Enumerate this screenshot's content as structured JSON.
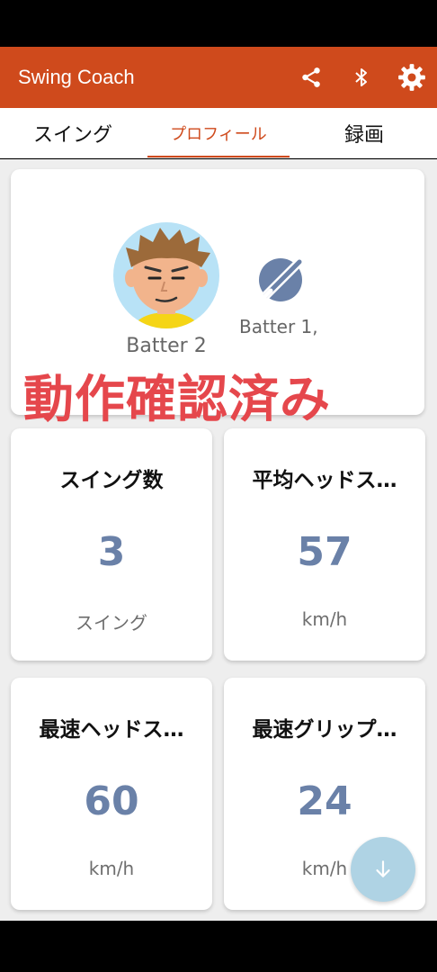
{
  "app": {
    "title": "Swing Coach"
  },
  "toolbar": {
    "share_icon": "share-icon",
    "bluetooth_icon": "bluetooth-icon",
    "settings_icon": "gear-icon"
  },
  "tabs": [
    {
      "label": "スイング",
      "active": false
    },
    {
      "label": "プロフィール",
      "active": true
    },
    {
      "label": "録画",
      "active": false
    }
  ],
  "profile": {
    "current_batter": "Batter 2",
    "other_batter": "Batter 1,"
  },
  "overlay": {
    "stamp_text": "動作確認済み"
  },
  "stats": [
    {
      "title": "スイング数",
      "value": "3",
      "unit": "スイング"
    },
    {
      "title": "平均ヘッドス…",
      "value": "57",
      "unit": "km/h"
    },
    {
      "title": "最速ヘッドス…",
      "value": "60",
      "unit": "km/h"
    },
    {
      "title": "最速グリップ…",
      "value": "24",
      "unit": "km/h"
    }
  ],
  "fab": {
    "icon": "arrow-down-icon"
  },
  "colors": {
    "accent": "#cf4a1c",
    "value": "#6a81a8",
    "stamp": "#e5474c"
  }
}
